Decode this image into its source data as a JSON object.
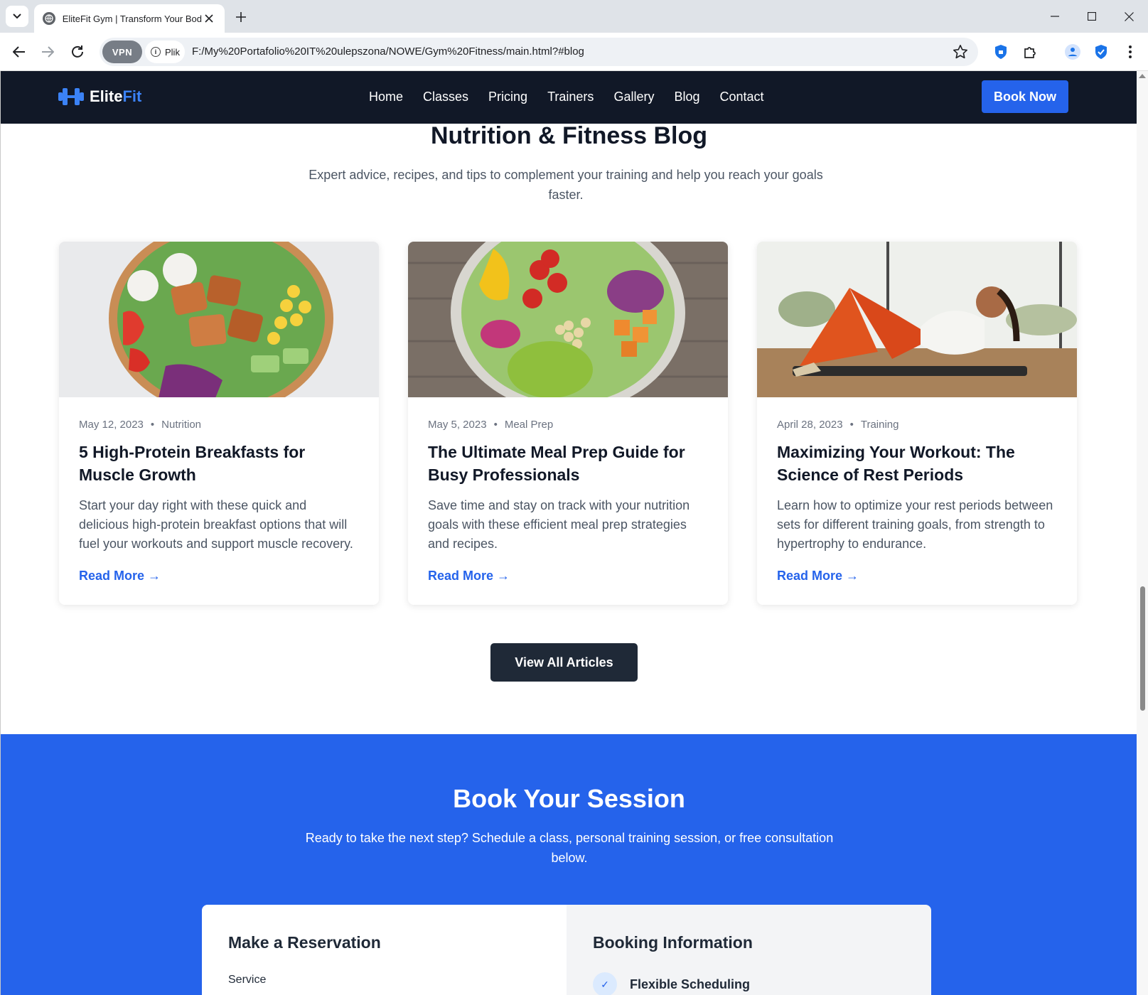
{
  "browser": {
    "tab_title": "EliteFit Gym | Transform Your Body",
    "url": "F:/My%20Portafolio%20IT%20ulepszona/NOWE/Gym%20Fitness/main.html?#blog",
    "vpn_label": "VPN",
    "site_info_label": "Plik"
  },
  "nav": {
    "logo_main": "Elite",
    "logo_accent": "Fit",
    "links": [
      "Home",
      "Classes",
      "Pricing",
      "Trainers",
      "Gallery",
      "Blog",
      "Contact"
    ],
    "cta": "Book Now"
  },
  "blog": {
    "title": "Nutrition & Fitness Blog",
    "subtitle": "Expert advice, recipes, and tips to complement your training and help you reach your goals faster.",
    "posts": [
      {
        "date": "May 12, 2023",
        "category": "Nutrition",
        "title": "5 High-Protein Breakfasts for Muscle Growth",
        "excerpt": "Start your day right with these quick and delicious high-protein breakfast options that will fuel your workouts and support muscle recovery.",
        "link": "Read More →"
      },
      {
        "date": "May 5, 2023",
        "category": "Meal Prep",
        "title": "The Ultimate Meal Prep Guide for Busy Professionals",
        "excerpt": "Save time and stay on track with your nutrition goals with these efficient meal prep strategies and recipes.",
        "link": "Read More →"
      },
      {
        "date": "April 28, 2023",
        "category": "Training",
        "title": "Maximizing Your Workout: The Science of Rest Periods",
        "excerpt": "Learn how to optimize your rest periods between sets for different training goals, from strength to hypertrophy to endurance.",
        "link": "Read More →"
      }
    ],
    "view_all": "View All Articles"
  },
  "booking": {
    "title": "Book Your Session",
    "subtitle": "Ready to take the next step? Schedule a class, personal training session, or free consultation below.",
    "left_heading": "Make a Reservation",
    "service_label": "Service",
    "right_heading": "Booking Information",
    "info_item": "Flexible Scheduling"
  },
  "colors": {
    "brand_blue": "#2563eb",
    "nav_dark": "#111827",
    "button_dark": "#1f2937"
  }
}
